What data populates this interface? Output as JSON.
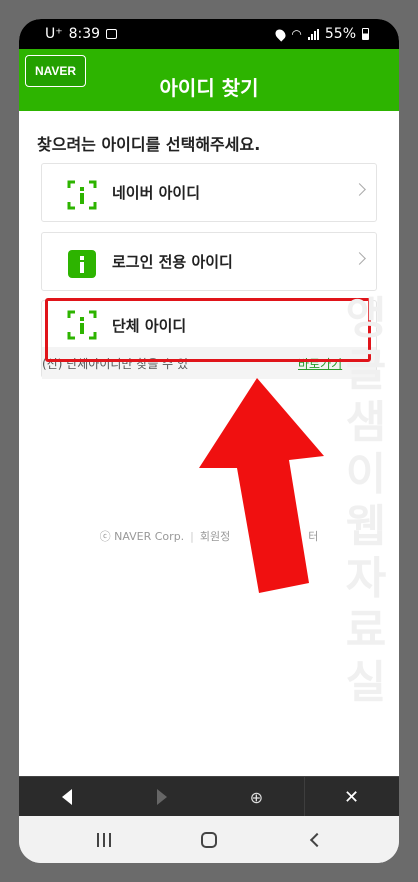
{
  "status_bar": {
    "carrier": "U⁺",
    "time": "8:39",
    "battery": "55%",
    "icons": [
      "picture-icon",
      "location-icon",
      "wifi-icon",
      "signal-icon",
      "battery-icon"
    ]
  },
  "header": {
    "logo": "NAVER",
    "title": "아이디 찾기",
    "color": "#2db400"
  },
  "main": {
    "prompt": "찾으려는 아이디를 선택해주세요.",
    "options": [
      {
        "label": "네이버 아이디",
        "icon": "id-outline-icon"
      },
      {
        "label": "로그인 전용 아이디",
        "icon": "id-filled-icon",
        "highlighted": true
      },
      {
        "label": "단체 아이디",
        "icon": "id-outline-icon"
      }
    ],
    "group_note": {
      "text": "(신) 단체아이디만 찾을 수 있",
      "link": "바로가기"
    }
  },
  "footer": {
    "copyright": "ⓒ NAVER Corp.",
    "link": "회원정",
    "link_tail": "터"
  },
  "watermark": "앵글샘이웹자료실",
  "annotation": {
    "arrow_color": "#e0141a",
    "box_color": "#e0141a"
  },
  "browser_toolbar": {
    "icons": [
      "back-icon",
      "forward-icon",
      "web-icon",
      "close-icon"
    ],
    "close_label": "✕"
  },
  "system_nav": {
    "icons": [
      "recents-icon",
      "home-icon",
      "back-nav-icon"
    ]
  }
}
